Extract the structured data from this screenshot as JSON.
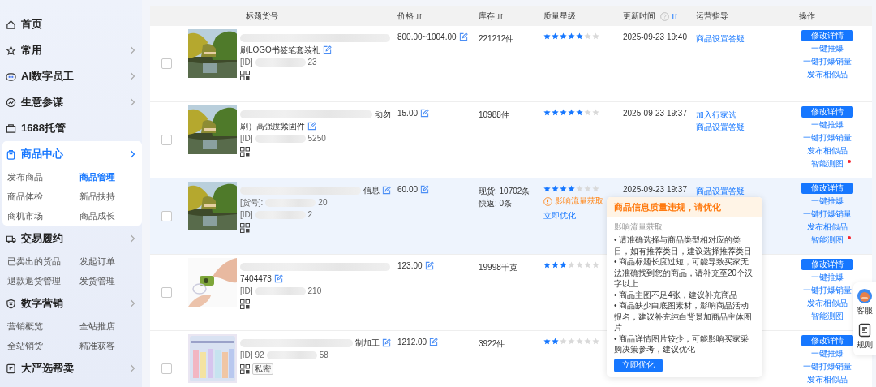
{
  "sidebar": {
    "items": [
      {
        "label": "首页",
        "selected": false
      },
      {
        "label": "常用",
        "chevron": true,
        "selected": false
      },
      {
        "label": "AI数字员工",
        "chevron": true,
        "selected": false
      },
      {
        "label": "生意参谋",
        "chevron": true,
        "selected": false
      },
      {
        "label": "1688托管",
        "selected": false
      },
      {
        "label": "商品中心",
        "chevron": true,
        "selected": true,
        "children": [
          {
            "label": "发布商品",
            "selected": false
          },
          {
            "label": "商品管理",
            "selected": true
          },
          {
            "label": "商品体检",
            "selected": false
          },
          {
            "label": "新品扶持",
            "selected": false
          },
          {
            "label": "商机市场",
            "selected": false
          },
          {
            "label": "商品成长",
            "selected": false
          }
        ]
      },
      {
        "label": "交易履约",
        "chevron": true,
        "selected": false,
        "children": [
          {
            "label": "已卖出的货品",
            "selected": false
          },
          {
            "label": "发起订单",
            "selected": false
          },
          {
            "label": "退款退货管理",
            "selected": false
          },
          {
            "label": "发货管理",
            "selected": false
          }
        ]
      },
      {
        "label": "数字营销",
        "chevron": true,
        "selected": false,
        "children": [
          {
            "label": "营销概览",
            "selected": false
          },
          {
            "label": "全站推店",
            "selected": false
          },
          {
            "label": "全站销货",
            "selected": false
          },
          {
            "label": "精准获客",
            "selected": false
          }
        ]
      },
      {
        "label": "大严选帮卖",
        "chevron": true,
        "selected": false
      }
    ]
  },
  "table": {
    "columns": [
      {
        "label": "标题货号"
      },
      {
        "label": "价格",
        "sortable": true
      },
      {
        "label": "库存",
        "sortable": true
      },
      {
        "label": "质量星级"
      },
      {
        "label": "更新时间",
        "sortable": true,
        "help": true
      },
      {
        "label": "运营指导"
      },
      {
        "label": "操作"
      }
    ],
    "rows": [
      {
        "checked": false,
        "title": [
          {
            "redacted": true
          },
          {
            "text": "刷LOGO书签笔套装礼",
            "editable": true
          }
        ],
        "codes": [
          {
            "label": "[ID]",
            "tail": "23"
          }
        ],
        "price": "800.00~1004.00",
        "stock": [
          "221212件"
        ],
        "stars": 5,
        "time": "2025-09-23 19:40",
        "guidance": [
          "商品设置答疑"
        ],
        "primary_action": "修改详情",
        "actions": [
          {
            "label": "一键推爆"
          },
          {
            "label": "一键打爆销量"
          },
          {
            "label": "发布相似品"
          }
        ]
      },
      {
        "checked": false,
        "title": [
          {
            "redacted": true,
            "text": "动勿"
          },
          {
            "text": "刷）高强度紧固件",
            "editable": true
          }
        ],
        "codes": [
          {
            "label": "[ID]",
            "tail": "5250"
          }
        ],
        "price": "15.00",
        "stock": [
          "10988件"
        ],
        "stars": 5,
        "time": "2025-09-23 19:37",
        "guidance": [
          "加入行家选",
          "商品设置答疑"
        ],
        "primary_action": "修改详情",
        "actions": [
          {
            "label": "一键推爆"
          },
          {
            "label": "一键打爆销量"
          },
          {
            "label": "发布相似品"
          },
          {
            "label": "智能测图",
            "dot": true
          }
        ]
      },
      {
        "checked": false,
        "highlighted": true,
        "title": [
          {
            "redacted": true,
            "text": "信息",
            "editable": true
          }
        ],
        "codes": [
          {
            "label": "[货号]:",
            "tail": "20"
          },
          {
            "label": "[ID]",
            "tail": "2"
          }
        ],
        "price": "60.00",
        "stock": [
          "现货: 10702条",
          "快返: 0条"
        ],
        "stars": 4,
        "warning": {
          "text": "影响流量获取",
          "link": "立即优化"
        },
        "time": "2025-09-23 19:37",
        "guidance": [
          "商品设置答疑"
        ],
        "primary_action": "修改详情",
        "actions": [
          {
            "label": "一键推爆"
          },
          {
            "label": "一键打爆销量"
          },
          {
            "label": "发布相似品"
          },
          {
            "label": "智能测图",
            "dot": true
          }
        ]
      },
      {
        "checked": false,
        "title": [
          {
            "redacted": true
          },
          {
            "text": "7404473",
            "editable": true
          }
        ],
        "codes": [
          {
            "label": "[ID]",
            "tail": "210"
          }
        ],
        "price": "123.00",
        "stock": [
          "19998千克"
        ],
        "stars": 3,
        "primary_action": "修改详情",
        "actions": [
          {
            "label": "一键推爆"
          },
          {
            "label": "一键打爆销量"
          },
          {
            "label": "发布相似品"
          },
          {
            "label": "智能测图"
          }
        ]
      },
      {
        "checked": false,
        "title": [
          {
            "redacted": true,
            "text": "制加工",
            "editable": true
          }
        ],
        "codes": [
          {
            "label": "[ID]",
            "head": "92",
            "tail": "58"
          }
        ],
        "tag": "私密",
        "price": "1212.00",
        "stock": [
          "3922件"
        ],
        "stars": 2,
        "primary_action": "修改详情",
        "actions": [
          {
            "label": "一键推爆"
          },
          {
            "label": "一键打爆销量"
          },
          {
            "label": "发布相似品"
          }
        ]
      }
    ]
  },
  "tooltip": {
    "title": "商品信息质量违规，请优化",
    "subtitle": "影响流量获取",
    "items": [
      "•  请准确选择与商品类型相对应的类目，如有推荐类目，建议选择推荐类目",
      "•  商品标题长度过短，可能导致买家无法准确找到您的商品，请补充至20个汉字以上",
      "•  商品主图不足4张，建议补充商品",
      "•  商品缺少白底图素材，影响商品活动报名，建议补充纯白背景加商品主体图片",
      "•  商品详情图片较少，可能影响买家采购决策参考，建议优化"
    ],
    "button": "立即优化"
  },
  "float_bar": [
    {
      "label": "客服"
    },
    {
      "label": "规则"
    }
  ]
}
